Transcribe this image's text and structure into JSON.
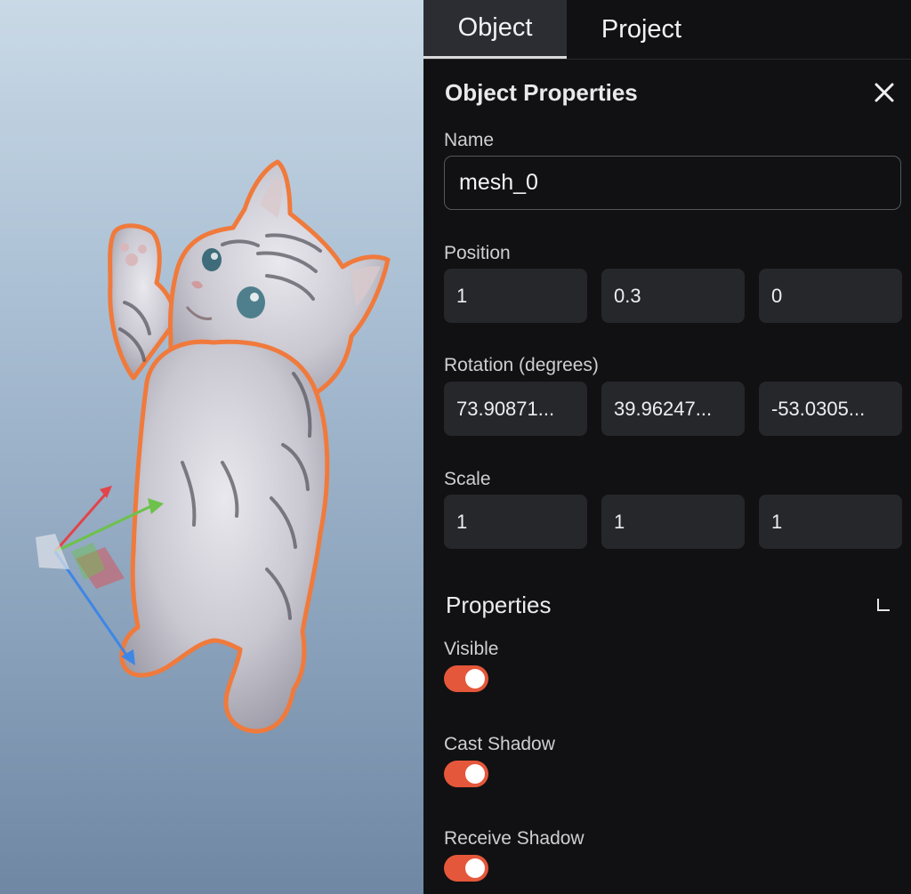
{
  "tabs": [
    {
      "label": "Object",
      "active": true
    },
    {
      "label": "Project",
      "active": false
    }
  ],
  "object_properties": {
    "title": "Object Properties",
    "name_label": "Name",
    "name_value": "mesh_0",
    "position_label": "Position",
    "position": [
      "1",
      "0.3",
      "0"
    ],
    "rotation_label": "Rotation (degrees)",
    "rotation": [
      "73.90871...",
      "39.96247...",
      "-53.0305..."
    ],
    "scale_label": "Scale",
    "scale": [
      "1",
      "1",
      "1"
    ]
  },
  "properties": {
    "title": "Properties",
    "toggles": [
      {
        "label": "Visible",
        "on": true
      },
      {
        "label": "Cast Shadow",
        "on": true
      },
      {
        "label": "Receive Shadow",
        "on": true
      }
    ]
  },
  "colors": {
    "accent": "#e5573a",
    "selection_outline": "#f07a3c",
    "panel_bg": "#111113",
    "field_bg": "#26272b",
    "gizmo_x": "#e2444a",
    "gizmo_y": "#6cc24a",
    "gizmo_z": "#3e86e6"
  },
  "viewport": {
    "object_icon": "kitten-model",
    "gizmo_icon": "transform-gizmo-icon"
  }
}
